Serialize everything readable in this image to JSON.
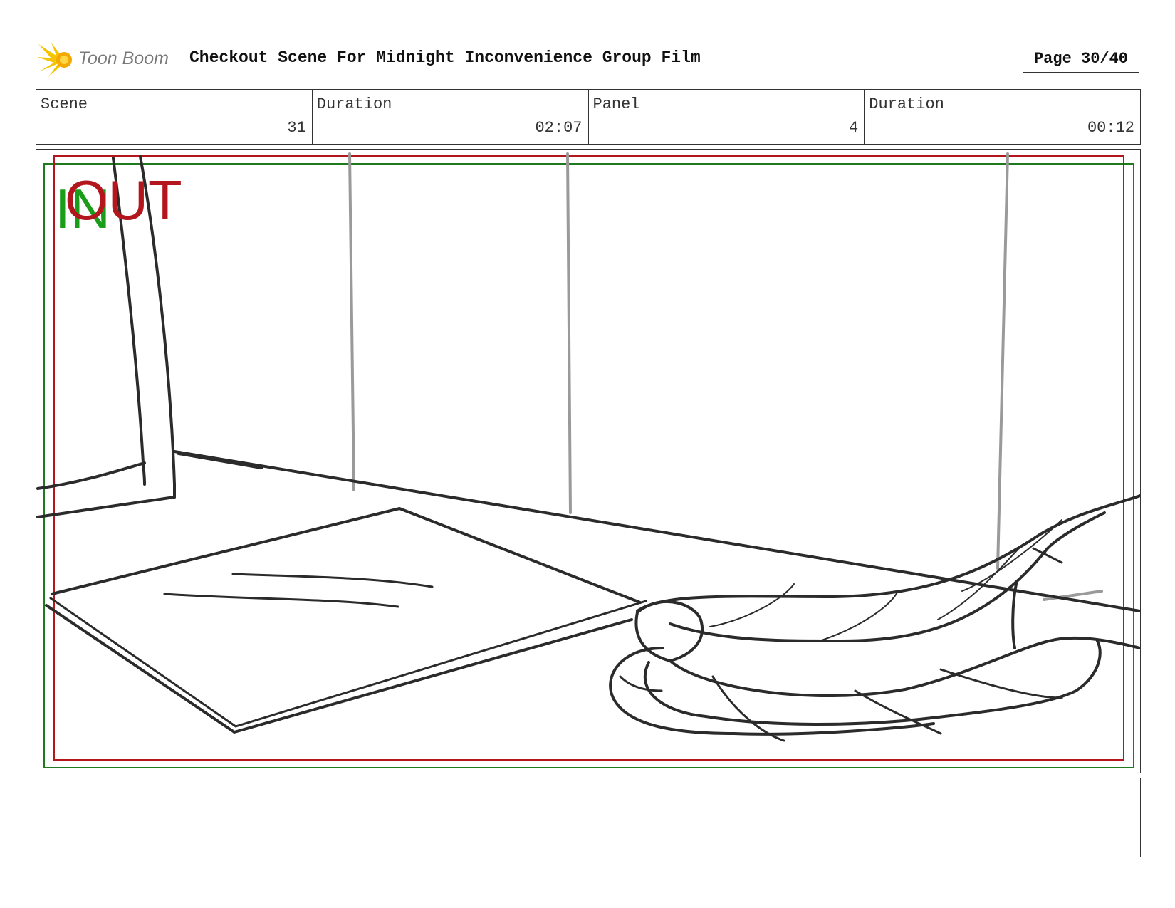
{
  "header": {
    "logo_text": "Toon Boom",
    "title": "Checkout Scene For Midnight Inconvenience Group Film",
    "page": "Page 30/40"
  },
  "info": [
    {
      "label": "Scene",
      "value": "31"
    },
    {
      "label": "Duration",
      "value": "02:07"
    },
    {
      "label": "Panel",
      "value": "4"
    },
    {
      "label": "Duration",
      "value": "00:12"
    }
  ],
  "panel": {
    "in_marker": "IN",
    "out_marker": "OUT",
    "colors": {
      "in": "#1a9e1a",
      "out": "#b3161c",
      "sketch": "#2b2b2b",
      "guide": "#9a9a9a"
    }
  },
  "notes": {
    "text": ""
  }
}
